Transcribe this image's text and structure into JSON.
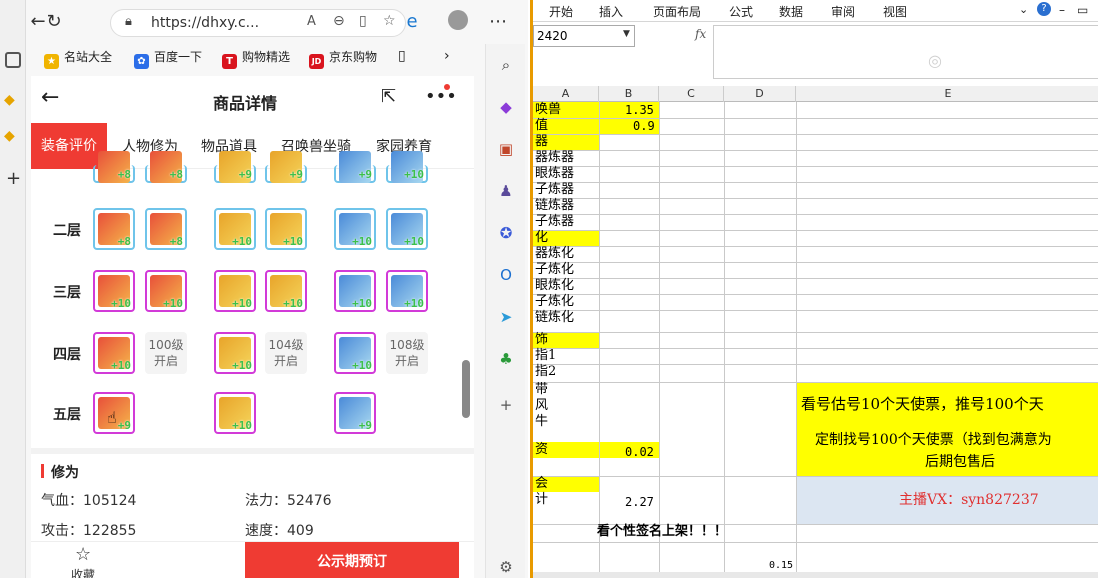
{
  "browser": {
    "url": "https://dhxy.c...",
    "bookmarks": [
      "名站大全",
      "百度一下",
      "购物精选",
      "京东购物"
    ]
  },
  "page": {
    "title": "商品详情",
    "tabs": [
      "装备评价",
      "人物修为",
      "物品道具",
      "召唤兽坐骑",
      "家园养育"
    ],
    "rows": [
      {
        "label": "二层"
      },
      {
        "label": "三层"
      },
      {
        "label": "四层"
      },
      {
        "label": "五层"
      }
    ],
    "row1_nums": [
      "+8",
      "+8",
      "+9",
      "+9",
      "+9",
      "+10"
    ],
    "row2_nums": [
      "+8",
      "+8",
      "+10",
      "+10",
      "+10",
      "+10"
    ],
    "row3_nums": [
      "+10",
      "+10",
      "+10",
      "+10",
      "+10",
      "+10"
    ],
    "row4_nums": [
      "+10",
      "+10",
      "+10"
    ],
    "row5_nums": [
      "+9",
      "+10",
      "+9"
    ],
    "locked": [
      {
        "l1": "100级",
        "l2": "开启"
      },
      {
        "l1": "104级",
        "l2": "开启"
      },
      {
        "l1": "108级",
        "l2": "开启"
      }
    ],
    "section_title": "修为",
    "stats": {
      "hp": "气血：105124",
      "mp": "法力：52476",
      "atk": "攻击：122855",
      "spd": "速度：409"
    },
    "bottom": {
      "fav": "收藏",
      "buy": "公示期预订"
    }
  },
  "excel": {
    "ribbon": [
      "开始",
      "插入",
      "页面布局",
      "公式",
      "数据",
      "审阅",
      "视图"
    ],
    "namebox": "2420",
    "fx": "fx",
    "columns": [
      "A",
      "B",
      "C",
      "D",
      "E"
    ],
    "col_a_cells": [
      "唤兽",
      "值",
      "器",
      "器炼器",
      "眼炼器",
      "子炼器",
      "链炼器",
      "子炼器",
      "化",
      "器炼化",
      "子炼化",
      "眼炼化",
      "子炼化",
      "链炼化",
      "饰",
      "指1",
      "指2",
      "带",
      "风",
      "牛",
      "资",
      "会",
      "计"
    ],
    "b_values": {
      "r1": "1.35",
      "r2": "0.9",
      "r21": "0.02",
      "r23": "2.27"
    },
    "ad_text": "看号估号10个天使票，推号100个天",
    "custom_text1": "定制找号100个天使票（找到包满意为",
    "custom_text2": "后期包售后",
    "anchor_text": "主播VX：syn827237",
    "bottom_text": "看个性签名上架！！！",
    "d_value": "0.15"
  }
}
